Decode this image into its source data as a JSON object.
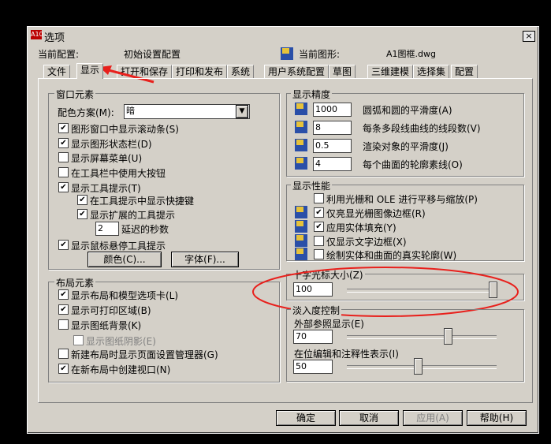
{
  "window": {
    "title": "选项",
    "close": "×",
    "app_icon": "A10"
  },
  "profile": {
    "label": "当前配置:",
    "value": "初始设置配置",
    "drawing_label": "当前图形:",
    "drawing_value": "A1图框.dwg"
  },
  "tabs": [
    "文件",
    "显示",
    "打开和保存",
    "打印和发布",
    "系统",
    "用户系统配置",
    "草图",
    "三维建模",
    "选择集",
    "配置"
  ],
  "window_elements": {
    "title": "窗口元素",
    "scheme_label": "配色方案(M):",
    "scheme_value": "暗",
    "items": [
      {
        "label": "图形窗口中显示滚动条(S)",
        "checked": true
      },
      {
        "label": "显示图形状态栏(D)",
        "checked": true
      },
      {
        "label": "显示屏幕菜单(U)",
        "checked": false
      },
      {
        "label": "在工具栏中使用大按钮",
        "checked": false
      },
      {
        "label": "显示工具提示(T)",
        "checked": true
      },
      {
        "label": "在工具提示中显示快捷键",
        "checked": true
      },
      {
        "label": "显示扩展的工具提示",
        "checked": true
      }
    ],
    "delay_value": "2",
    "delay_label": "延迟的秒数",
    "hover_label": "显示鼠标悬停工具提示",
    "hover_checked": true,
    "colors_btn": "颜色(C)...",
    "fonts_btn": "字体(F)..."
  },
  "layout_elements": {
    "title": "布局元素",
    "items": [
      {
        "label": "显示布局和模型选项卡(L)",
        "checked": true
      },
      {
        "label": "显示可打印区域(B)",
        "checked": true
      },
      {
        "label": "显示图纸背景(K)",
        "checked": false
      },
      {
        "label": "显示图纸阴影(E)",
        "checked": false
      },
      {
        "label": "新建布局时显示页面设置管理器(G)",
        "checked": false
      },
      {
        "label": "在新布局中创建视口(N)",
        "checked": true
      }
    ]
  },
  "display_resolution": {
    "title": "显示精度",
    "items": [
      {
        "value": "1000",
        "label": "圆弧和圆的平滑度(A)"
      },
      {
        "value": "8",
        "label": "每条多段线曲线的线段数(V)"
      },
      {
        "value": "0.5",
        "label": "渲染对象的平滑度(J)"
      },
      {
        "value": "4",
        "label": "每个曲面的轮廓素线(O)"
      }
    ]
  },
  "display_performance": {
    "title": "显示性能",
    "items": [
      {
        "label": "利用光栅和 OLE 进行平移与缩放(P)",
        "checked": false
      },
      {
        "label": "仅亮显光栅图像边框(R)",
        "checked": true
      },
      {
        "label": "应用实体填充(Y)",
        "checked": true
      },
      {
        "label": "仅显示文字边框(X)",
        "checked": false
      },
      {
        "label": "绘制实体和曲面的真实轮廓(W)",
        "checked": false
      }
    ]
  },
  "crosshair": {
    "title": "十字光标大小(Z)",
    "value": "100",
    "level_percent": 100
  },
  "fade": {
    "title": "淡入度控制",
    "xref_label": "外部参照显示(E)",
    "xref_value": "70",
    "xref_level_percent": 70,
    "inplace_label": "在位编辑和注释性表示(I)",
    "inplace_value": "50",
    "inplace_level_percent": 50
  },
  "buttons": {
    "ok": "确定",
    "cancel": "取消",
    "apply": "应用(A)",
    "help": "帮助(H)"
  },
  "colors": {
    "dialog_bg": "#d4d0c8",
    "annotation_red": "#e8201c"
  }
}
